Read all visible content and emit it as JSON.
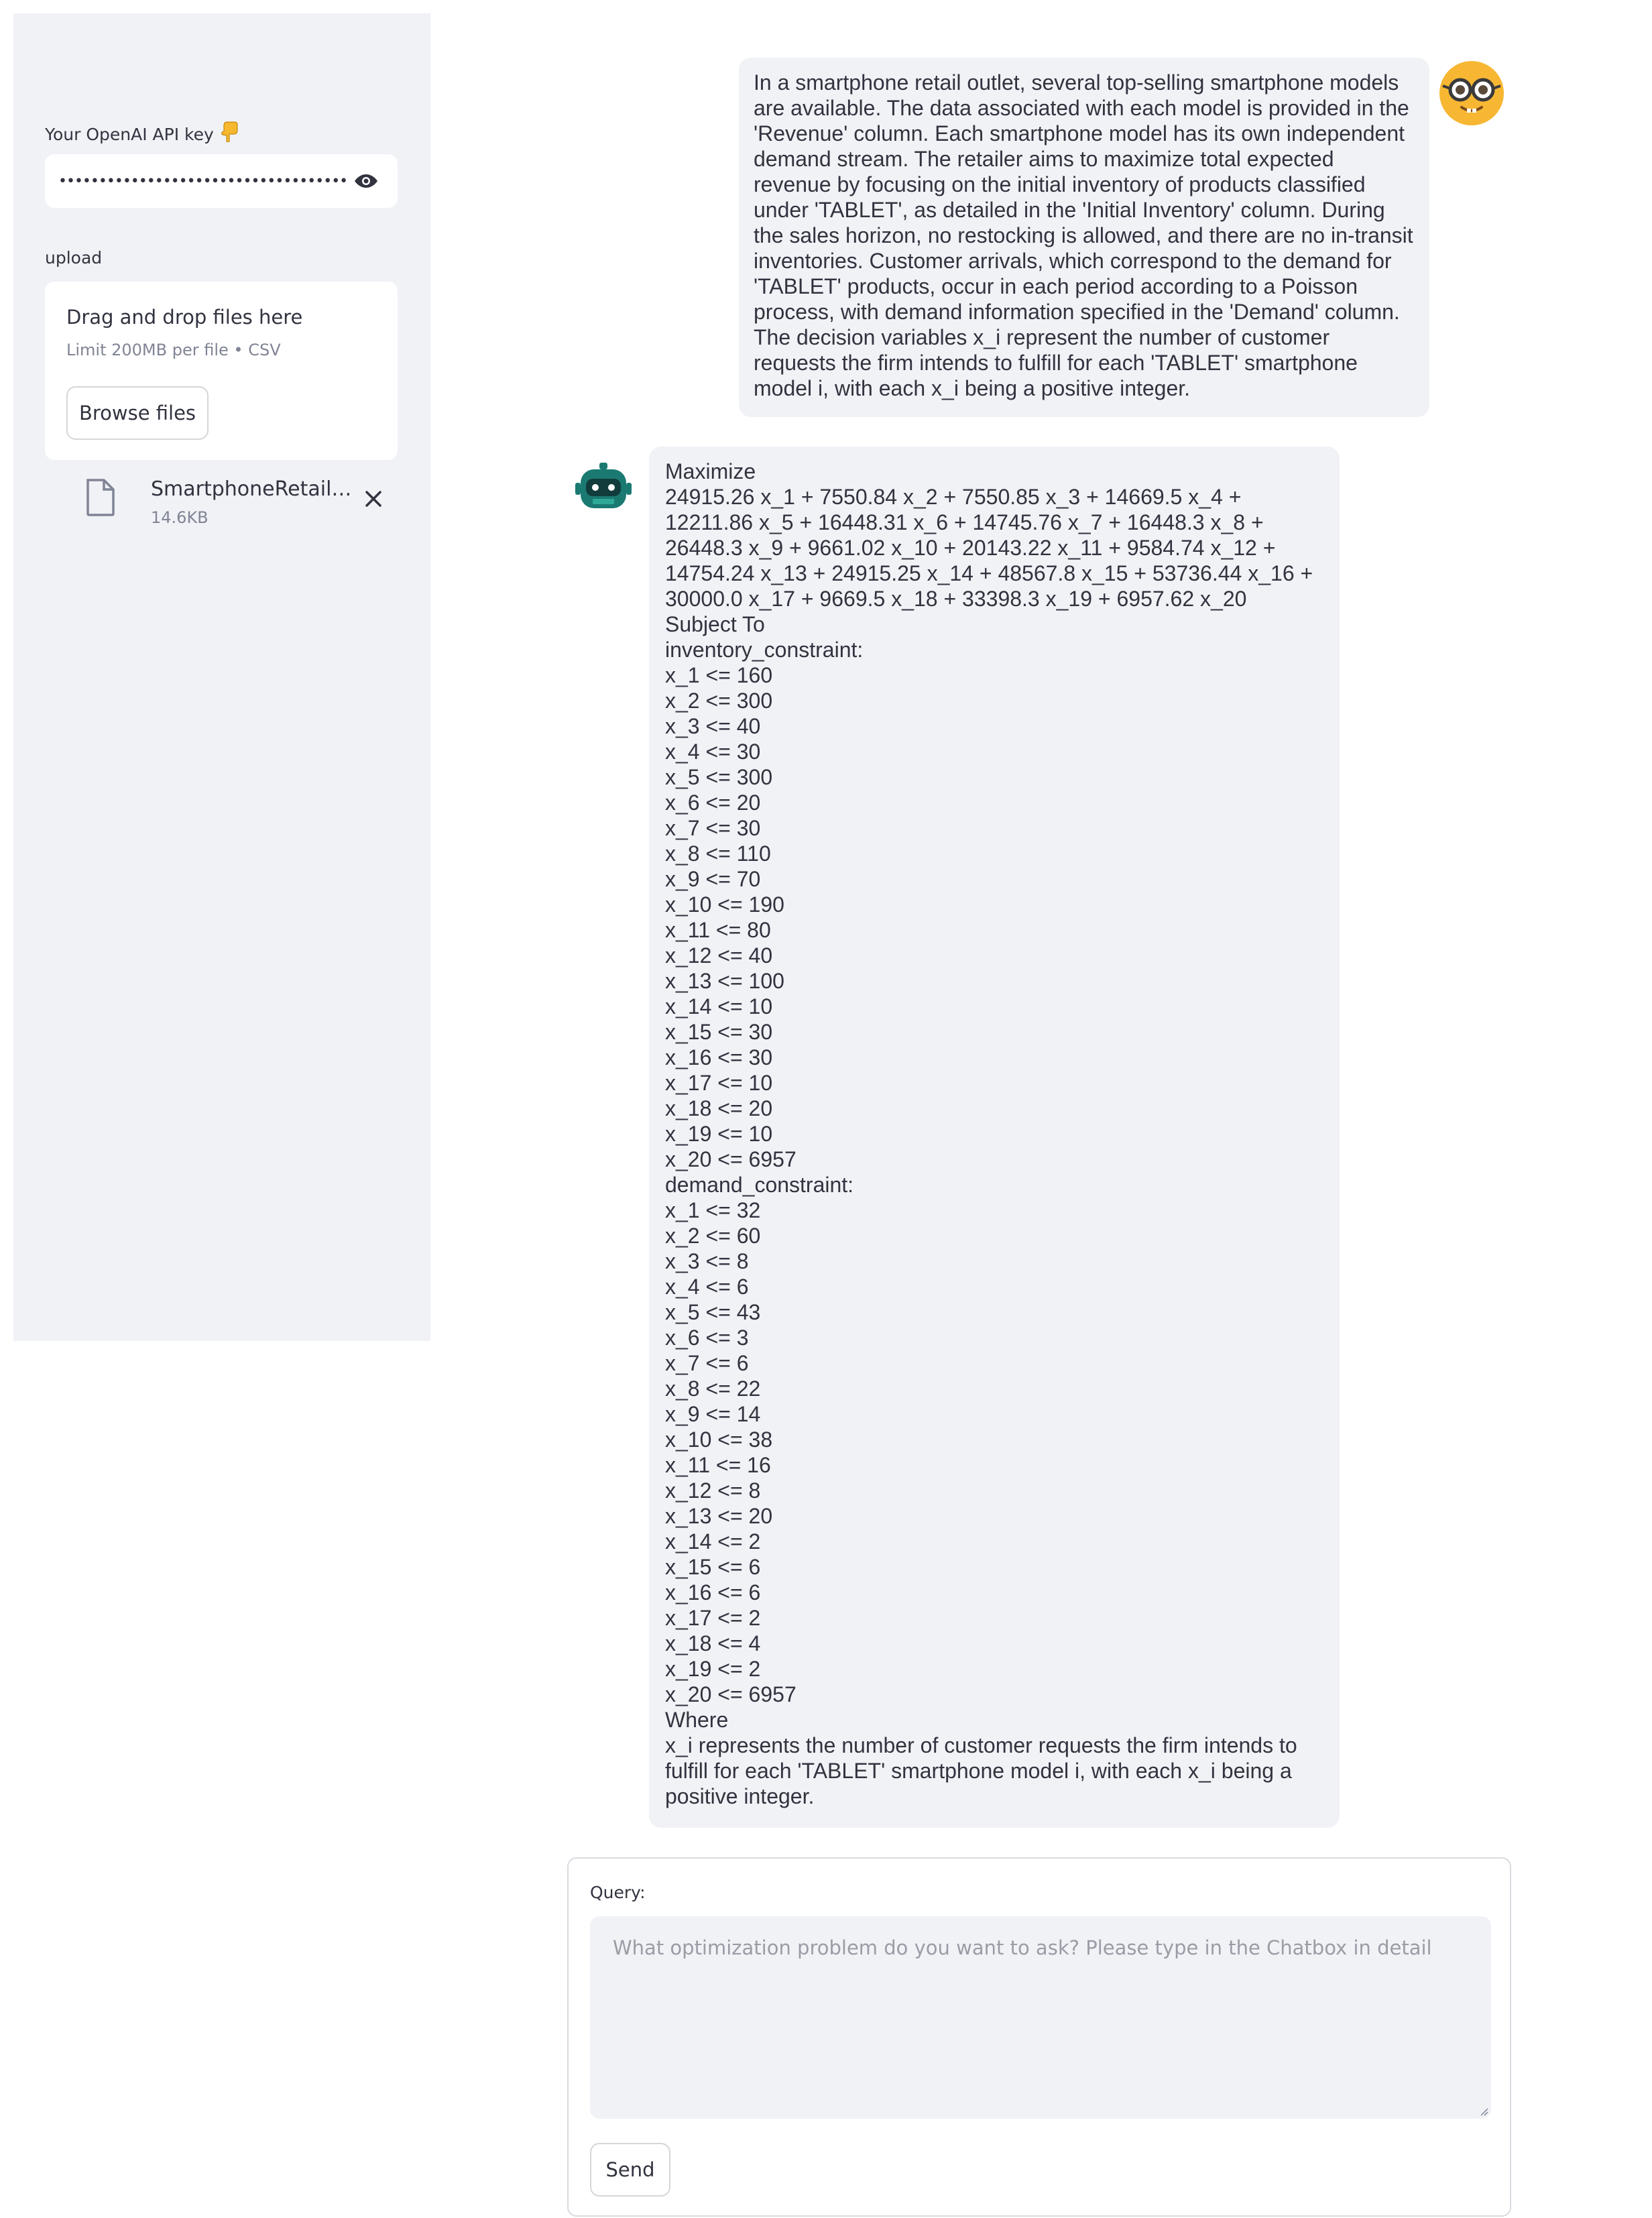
{
  "sidebar": {
    "api_key_label": "Your OpenAI API key",
    "api_key_label_icon": "pointing-down-hand-icon",
    "api_key_masked": "••••••••••••••••••••••••••••••••••••••••",
    "upload_label": "upload",
    "dropzone_title": "Drag and drop files here",
    "dropzone_limit": "Limit 200MB per file • CSV",
    "browse_button": "Browse files",
    "uploaded_file": {
      "name": "SmartphoneRetailOu...",
      "size": "14.6KB"
    }
  },
  "chat": {
    "user_message": "In a smartphone retail outlet, several top-selling smartphone models\nare available. The data associated with each model is provided in the\n'Revenue' column. Each smartphone model has its own independent\ndemand stream. The retailer aims to maximize total expected\nrevenue by focusing on the initial inventory of products classified\nunder 'TABLET', as detailed in the 'Initial Inventory' column. During\nthe sales horizon, no restocking is allowed, and there are no in-transit\ninventories. Customer arrivals, which correspond to the demand for\n'TABLET' products, occur in each period according to a Poisson\nprocess, with demand information specified in the 'Demand' column.\nThe decision variables x_i represent the number of customer\nrequests the firm intends to fulfill for each 'TABLET' smartphone\nmodel i, with each x_i being a positive integer.",
    "assistant_message": "Maximize\n24915.26 x_1 + 7550.84 x_2 + 7550.85 x_3 + 14669.5 x_4 +\n12211.86 x_5 + 16448.31 x_6 + 14745.76 x_7 + 16448.3 x_8 +\n26448.3 x_9 + 9661.02 x_10 + 20143.22 x_11 + 9584.74 x_12 +\n14754.24 x_13 + 24915.25 x_14 + 48567.8 x_15 + 53736.44 x_16 +\n30000.0 x_17 + 9669.5 x_18 + 33398.3 x_19 + 6957.62 x_20\nSubject To\ninventory_constraint:\nx_1 <= 160\nx_2 <= 300\nx_3 <= 40\nx_4 <= 30\nx_5 <= 300\nx_6 <= 20\nx_7 <= 30\nx_8 <= 110\nx_9 <= 70\nx_10 <= 190\nx_11 <= 80\nx_12 <= 40\nx_13 <= 100\nx_14 <= 10\nx_15 <= 30\nx_16 <= 30\nx_17 <= 10\nx_18 <= 20\nx_19 <= 10\nx_20 <= 6957\ndemand_constraint:\nx_1 <= 32\nx_2 <= 60\nx_3 <= 8\nx_4 <= 6\nx_5 <= 43\nx_6 <= 3\nx_7 <= 6\nx_8 <= 22\nx_9 <= 14\nx_10 <= 38\nx_11 <= 16\nx_12 <= 8\nx_13 <= 20\nx_14 <= 2\nx_15 <= 6\nx_16 <= 6\nx_17 <= 2\nx_18 <= 4\nx_19 <= 2\nx_20 <= 6957\nWhere\nx_i represents the number of customer requests the firm intends to\nfulfill for each 'TABLET' smartphone model i, with each x_i being a\npositive integer."
  },
  "query": {
    "label": "Query:",
    "placeholder": "What optimization problem do you want to ask? Please type in the Chatbox in detail",
    "value": "",
    "send_button": "Send"
  },
  "colors": {
    "sidebar_bg": "#f0f2f6",
    "bubble_bg": "#f0f2f6",
    "text": "#31333f",
    "muted_text": "#808495",
    "user_avatar": "#f7b733",
    "bot_avatar": "#1a7a72"
  }
}
